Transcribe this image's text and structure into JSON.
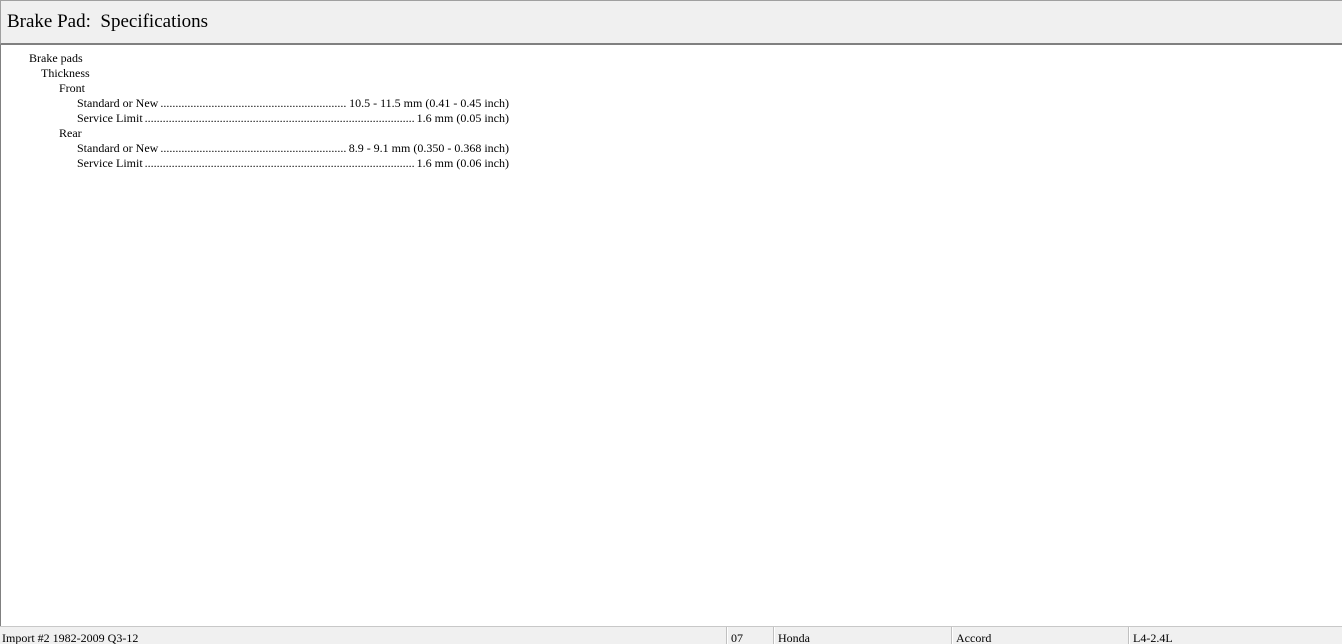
{
  "window": {
    "title": "Brake Pad:  Specifications"
  },
  "specs": {
    "heading": "Brake pads",
    "subheading": "Thickness",
    "front": {
      "label": "Front",
      "rows": [
        {
          "label": "Standard or New",
          "value": "10.5 - 11.5 mm (0.41 - 0.45 inch)"
        },
        {
          "label": "Service Limit",
          "value": "1.6 mm (0.05 inch)"
        }
      ]
    },
    "rear": {
      "label": "Rear",
      "rows": [
        {
          "label": "Standard or New",
          "value": "8.9 - 9.1 mm (0.350 - 0.368 inch)"
        },
        {
          "label": "Service Limit",
          "value": "1.6 mm (0.06 inch)"
        }
      ]
    }
  },
  "status_bar": {
    "database": "Import #2 1982-2009 Q3-12",
    "year": "07",
    "make": "Honda",
    "model": "Accord",
    "engine": "L4-2.4L"
  }
}
